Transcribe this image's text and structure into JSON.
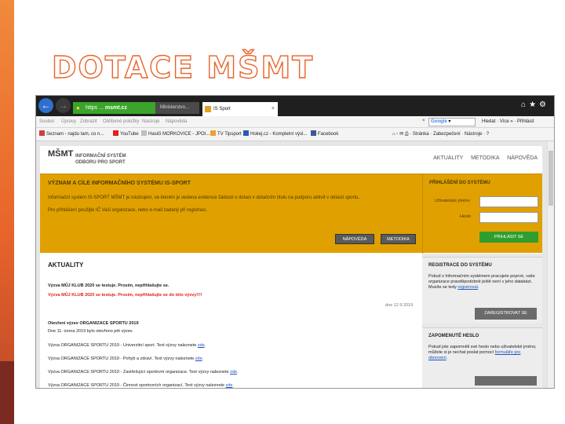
{
  "slide": {
    "title": "DOTACE MŠMT"
  },
  "browser": {
    "url_scheme": "https",
    "url_domain": "msmt.cz",
    "cert_label": "Ministerstvo...",
    "tab_title": "IS Sport",
    "menu": [
      "Soubor",
      "Úpravy",
      "Zobrazit",
      "Oblíbené položky",
      "Nástroje",
      "Nápověda"
    ],
    "search_engine": "Google",
    "search_tools": [
      "Hledat",
      "Více »",
      "Přihlásit"
    ],
    "favorites": [
      "Seznam - najdu tam, co n...",
      "YouTube",
      "Hasiči MORKOVICE - JPOI...",
      "TV Tipsport",
      "Hokej.cz - Kompletní výsl...",
      "Facebook"
    ],
    "page_tools": [
      "Stránka",
      "Zabezpečení",
      "Nástroje"
    ]
  },
  "site": {
    "logo": "MŠMT",
    "logo_line1": "INFORMAČNÍ SYSTÉM",
    "logo_line2": "ODBORU PRO SPORT",
    "nav": [
      "AKTUALITY",
      "METODIKA",
      "NÁPOVĚDA"
    ],
    "hero": {
      "title": "VÝZNAM A CÍLE INFORMAČNÍHO SYSTÉMU IS-SPORT",
      "p1": "Informační systém IS-SPORT MŠMT je nástrojem, ve kterém je vedena evidence žádostí o dotaci v dotačním titulu na podporu aktivit v oblasti sportu.",
      "p2": "Pro přihlášení použijte IČ Vaší organizace, nebo e-mail zadaný při registraci.",
      "btn_help": "NÁPOVĚDA",
      "btn_method": "METODIKA"
    },
    "login": {
      "title": "PŘIHLÁŠENÍ DO SYSTÉMU",
      "user_label": "Uživatelské jméno",
      "pass_label": "Heslo",
      "submit": "PŘIHLÁSIT SE"
    },
    "news": {
      "title": "AKTUALITY",
      "item1_title": "Výzva MŮJ KLUB 2020 se testuje. Prosím, nepřihlašujte se.",
      "item1_warning": "Výzva MŮJ KLUB 2020 se testuje. Prosím, nepřihlašujte se do této výzvy!!!!",
      "item1_date": "dne 12.9.2019",
      "item2_title": "Otevření výzev ORGANIZACE SPORTU 2019",
      "item2_p": "Dne 11. února 2019 bylo otevřeno pět výzev.",
      "lines": [
        "Výzva ORGANIZACE SPORTU 2019 - Univerzitní sport. Text výzvy naleznete",
        "Výzva ORGANIZACE SPORTU 2019 - Pohyb a zdraví. Text výzvy naleznete",
        "Výzva ORGANIZACE SPORTU 2019 - Zastřešující sportovní organizace. Text výzvy naleznete",
        "Výzva ORGANIZACE SPORTU 2019 - Činnost sportovních organizací. Text výzvy naleznete"
      ],
      "link": "zde"
    },
    "register": {
      "title": "REGISTRACE DO SYSTÉMU",
      "text": "Pokud s Informačním systémem pracujete poprvé, vaše organizace pravděpodobně ještě není v jeho databázi. Musíte se tedy",
      "link": "registrovat",
      "button": "ZAREGISTROVAT SE"
    },
    "forgot": {
      "title": "ZAPOMENUTÉ HESLO",
      "text": "Pokud jste zapomněli své heslo nebo uživatelské jméno, můžete si je nechat poslat pomocí",
      "link": "formuláře pro obnovení"
    }
  }
}
